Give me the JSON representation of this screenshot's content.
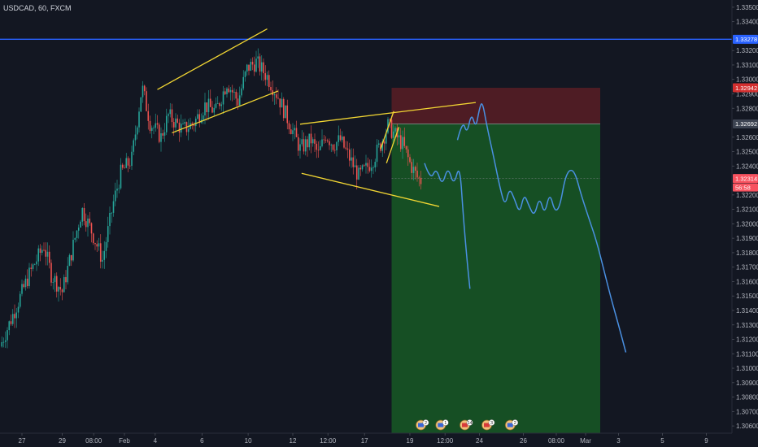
{
  "title": "USDCAD, 60, FXCM",
  "colors": {
    "background": "#131722",
    "up": "#26a69a",
    "down": "#ef5350",
    "hline": "#2962ff",
    "trend": "#f2d633",
    "projection": "#4a90e2",
    "stop_zone": "rgba(206,40,40,0.32)",
    "target_zone": "rgba(30,170,40,0.38)",
    "label_blue": "#2962ff",
    "label_red": "#d32f2f",
    "label_grey": "#3d4452",
    "label_pink": "#f7525f"
  },
  "chart_data": {
    "type": "candlestick",
    "ylim": [
      1.3055,
      1.3355
    ],
    "xlim": [
      0,
      100
    ],
    "y_ticks": [
      "1.33500",
      "1.33400",
      "1.33200",
      "1.33100",
      "1.33000",
      "1.32900",
      "1.32800",
      "1.32600",
      "1.32500",
      "1.32400",
      "1.32200",
      "1.32100",
      "1.32000",
      "1.31900",
      "1.31800",
      "1.31700",
      "1.31600",
      "1.31500",
      "1.31400",
      "1.31300",
      "1.31200",
      "1.31100",
      "1.31000",
      "1.30900",
      "1.30800",
      "1.30700",
      "1.30600",
      "1.30500"
    ],
    "x_ticks": [
      {
        "x": 3,
        "label": "27"
      },
      {
        "x": 8.5,
        "label": "29"
      },
      {
        "x": 12.8,
        "label": "08:00"
      },
      {
        "x": 17,
        "label": "Feb"
      },
      {
        "x": 21.2,
        "label": "4"
      },
      {
        "x": 27.6,
        "label": "6"
      },
      {
        "x": 33.9,
        "label": "10"
      },
      {
        "x": 40,
        "label": "12"
      },
      {
        "x": 44.8,
        "label": "12:00"
      },
      {
        "x": 49.8,
        "label": "17"
      },
      {
        "x": 56,
        "label": "19"
      },
      {
        "x": 60.8,
        "label": "12:00"
      },
      {
        "x": 65.5,
        "label": "24"
      },
      {
        "x": 71.5,
        "label": "26"
      },
      {
        "x": 76,
        "label": "08:00"
      },
      {
        "x": 80,
        "label": "Mar"
      },
      {
        "x": 84.5,
        "label": "3"
      },
      {
        "x": 90.5,
        "label": "5"
      },
      {
        "x": 96.5,
        "label": "9"
      }
    ],
    "price_labels": [
      {
        "value": "1.33278",
        "kind": "blue"
      },
      {
        "value": "1.32942",
        "kind": "red"
      },
      {
        "value": "1.32692",
        "kind": "grey"
      },
      {
        "value": "1.32314",
        "kind": "pink"
      },
      {
        "value": "56:58",
        "kind": "pink_small"
      }
    ],
    "horizontal_line": 1.33278,
    "anchors": [
      [
        0,
        1.3115
      ],
      [
        2,
        1.314
      ],
      [
        4,
        1.3165
      ],
      [
        6,
        1.3185
      ],
      [
        7,
        1.3165
      ],
      [
        8.5,
        1.3153
      ],
      [
        10,
        1.3185
      ],
      [
        11.2,
        1.321
      ],
      [
        12.5,
        1.3195
      ],
      [
        14,
        1.3175
      ],
      [
        15.5,
        1.3215
      ],
      [
        16.5,
        1.3235
      ],
      [
        18,
        1.3245
      ],
      [
        19.4,
        1.3295
      ],
      [
        20.5,
        1.327
      ],
      [
        22,
        1.326
      ],
      [
        23,
        1.3275
      ],
      [
        25,
        1.3265
      ],
      [
        26.5,
        1.327
      ],
      [
        28,
        1.3282
      ],
      [
        29.5,
        1.3278
      ],
      [
        31,
        1.3298
      ],
      [
        32.5,
        1.3285
      ],
      [
        33.8,
        1.3308
      ],
      [
        35,
        1.3312
      ],
      [
        36.5,
        1.3302
      ],
      [
        38,
        1.3288
      ],
      [
        39.5,
        1.327
      ],
      [
        41,
        1.3252
      ],
      [
        42.5,
        1.3258
      ],
      [
        43.5,
        1.3248
      ],
      [
        44.5,
        1.3262
      ],
      [
        45.5,
        1.3255
      ],
      [
        46.5,
        1.3258
      ],
      [
        47.5,
        1.3248
      ],
      [
        49,
        1.3233
      ],
      [
        50,
        1.3238
      ],
      [
        51,
        1.3245
      ],
      [
        52,
        1.3255
      ],
      [
        53,
        1.3268
      ],
      [
        53.9,
        1.3262
      ],
      [
        55,
        1.3255
      ],
      [
        56,
        1.3242
      ],
      [
        57,
        1.3232
      ],
      [
        57.5,
        1.323
      ]
    ],
    "trendlines": [
      [
        [
          21.5,
          1.3293
        ],
        [
          36.5,
          1.3335
        ]
      ],
      [
        [
          23.5,
          1.3263
        ],
        [
          38,
          1.3292
        ]
      ],
      [
        [
          41,
          1.3269
        ],
        [
          65,
          1.3284
        ]
      ],
      [
        [
          41.2,
          1.3235
        ],
        [
          60,
          1.3212
        ]
      ],
      [
        [
          52,
          1.3252
        ],
        [
          53.8,
          1.3278
        ]
      ],
      [
        [
          52.8,
          1.3242
        ],
        [
          54.5,
          1.3267
        ]
      ]
    ],
    "zones": [
      {
        "name": "stop",
        "x0": 53.5,
        "x1": 82,
        "y0": 1.32692,
        "y1": 1.32942
      },
      {
        "name": "target",
        "x0": 53.5,
        "x1": 82,
        "y0": 1.3055,
        "y1": 1.32692
      }
    ],
    "zone_line": 1.32692,
    "entry_line": 1.32314,
    "projection_1": [
      [
        58,
        1.3242
      ],
      [
        58.8,
        1.323
      ],
      [
        59.6,
        1.3239
      ],
      [
        60.4,
        1.3226
      ],
      [
        61.2,
        1.324
      ],
      [
        62.0,
        1.3226
      ],
      [
        62.8,
        1.3242
      ],
      [
        63.3,
        1.3205
      ],
      [
        63.8,
        1.3175
      ],
      [
        64.2,
        1.3155
      ]
    ],
    "projection_2": [
      [
        62.5,
        1.3258
      ],
      [
        63.2,
        1.3272
      ],
      [
        63.8,
        1.3262
      ],
      [
        64.4,
        1.3277
      ],
      [
        65.0,
        1.3266
      ],
      [
        65.5,
        1.328
      ],
      [
        65.9,
        1.3285
      ],
      [
        66.5,
        1.3268
      ],
      [
        67.5,
        1.3245
      ],
      [
        68.3,
        1.3225
      ],
      [
        69.0,
        1.3212
      ],
      [
        69.6,
        1.3225
      ],
      [
        70.3,
        1.3217
      ],
      [
        71.0,
        1.3207
      ],
      [
        71.6,
        1.3221
      ],
      [
        72.3,
        1.3212
      ],
      [
        73.0,
        1.3205
      ],
      [
        73.7,
        1.3219
      ],
      [
        74.4,
        1.3206
      ],
      [
        75.1,
        1.3222
      ],
      [
        75.8,
        1.3208
      ],
      [
        76.5,
        1.3212
      ],
      [
        77.2,
        1.3232
      ],
      [
        77.9,
        1.3238
      ],
      [
        78.6,
        1.3235
      ],
      [
        79.4,
        1.322
      ],
      [
        80.5,
        1.3203
      ],
      [
        81.5,
        1.3188
      ],
      [
        82.5,
        1.3168
      ],
      [
        83.5,
        1.3148
      ],
      [
        84.5,
        1.313
      ],
      [
        85.5,
        1.3111
      ]
    ],
    "events": [
      {
        "x": 57.5,
        "count": "2",
        "flag": "blue"
      },
      {
        "x": 60.2,
        "count": "1",
        "flag": "blue"
      },
      {
        "x": 63.5,
        "count": "14",
        "flag": "red"
      },
      {
        "x": 66.5,
        "count": "3",
        "flag": "red"
      },
      {
        "x": 69.7,
        "count": "2",
        "flag": "blue"
      }
    ]
  }
}
